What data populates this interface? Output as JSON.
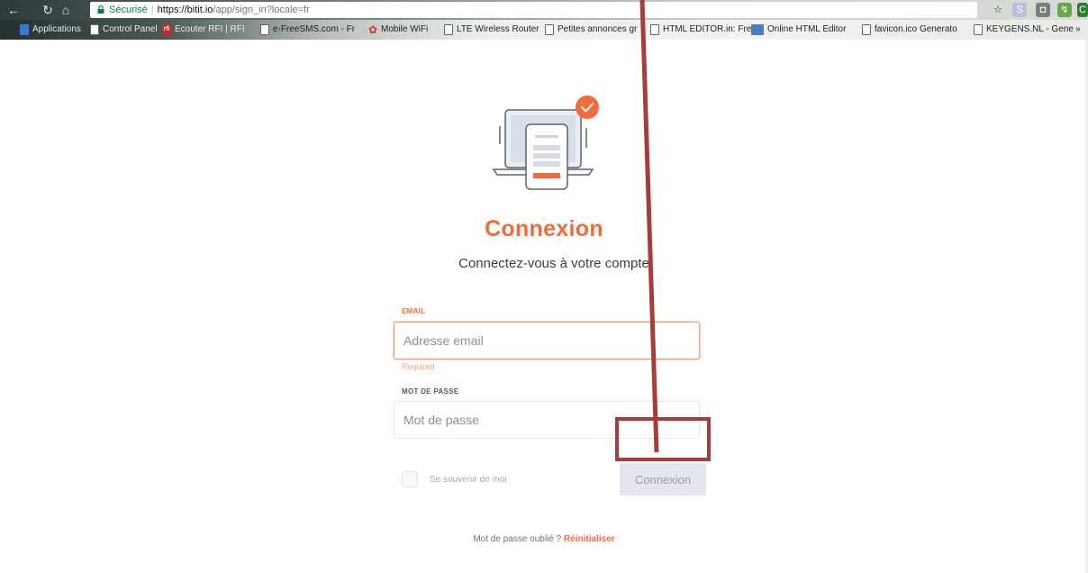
{
  "browser": {
    "secure_label": "Sécurisé",
    "url_host": "https://bitit.io",
    "url_path": "/app/sign_in?locale=fr",
    "bookmarks": [
      "Applications",
      "Control Panel",
      "Ecouter RFI | RFI",
      "e-FreeSMS.com - Fr",
      "Mobile WiFi",
      "LTE Wireless Router",
      "Petites annonces gr",
      "HTML EDITOR.in: Fre",
      "Online HTML Editor",
      "favicon.ico Generato",
      "KEYGENS.NL - Gene"
    ]
  },
  "page": {
    "title": "Connexion",
    "subtitle": "Connectez-vous à votre compte",
    "email": {
      "label": "EMAIL",
      "placeholder": "Adresse email",
      "error": "Required"
    },
    "password": {
      "label": "MOT DE PASSE",
      "placeholder": "Mot de passe"
    },
    "remember_label": "Se souvenir de moi",
    "submit_label": "Connexion",
    "forgot_text": "Mot de passe oublié ?",
    "forgot_link": "Réinitialiser"
  },
  "colors": {
    "brand_orange": "#f26b3a",
    "annotation_red": "#a83c3c",
    "button_bg": "#e4e6ee"
  },
  "icons": {
    "hero": "laptop-phone-check-illustration"
  }
}
